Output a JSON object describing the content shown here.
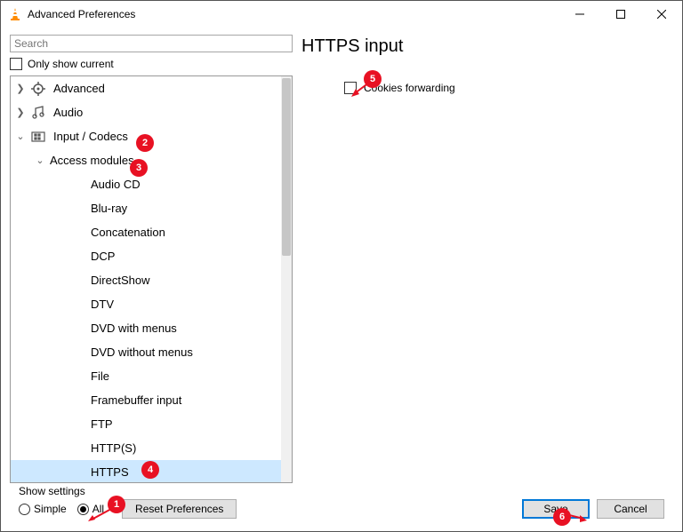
{
  "window": {
    "title": "Advanced Preferences"
  },
  "search": {
    "placeholder": "Search"
  },
  "only_current_label": "Only show current",
  "tree": {
    "items": [
      {
        "label": "Advanced",
        "icon": "gear"
      },
      {
        "label": "Audio",
        "icon": "music"
      },
      {
        "label": "Input / Codecs",
        "icon": "codec"
      },
      {
        "label": "Access modules"
      },
      {
        "label": "Audio CD"
      },
      {
        "label": "Blu-ray"
      },
      {
        "label": "Concatenation"
      },
      {
        "label": "DCP"
      },
      {
        "label": "DirectShow"
      },
      {
        "label": "DTV"
      },
      {
        "label": "DVD with menus"
      },
      {
        "label": "DVD without menus"
      },
      {
        "label": "File"
      },
      {
        "label": "Framebuffer input"
      },
      {
        "label": "FTP"
      },
      {
        "label": "HTTP(S)"
      },
      {
        "label": "HTTPS"
      }
    ]
  },
  "panel": {
    "title": "HTTPS input",
    "option1": "Cookies forwarding"
  },
  "footer": {
    "show_settings": "Show settings",
    "simple": "Simple",
    "all": "All",
    "reset": "Reset Preferences",
    "save": "Save",
    "cancel": "Cancel"
  },
  "annotations": {
    "a1": "1",
    "a2": "2",
    "a3": "3",
    "a4": "4",
    "a5": "5",
    "a6": "6"
  }
}
